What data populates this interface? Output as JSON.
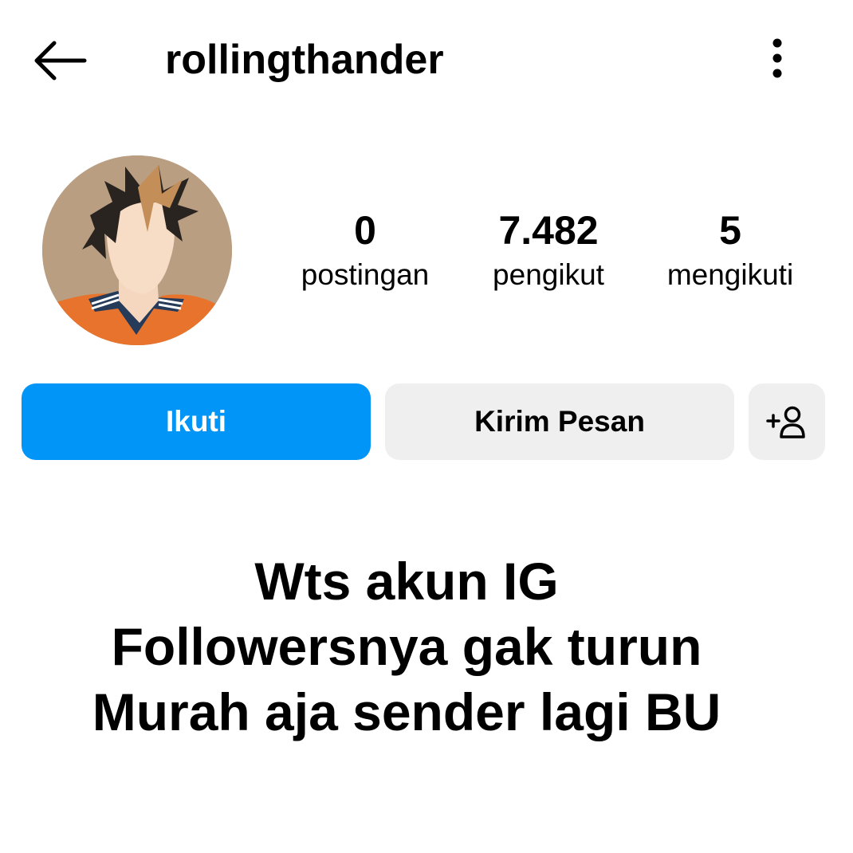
{
  "header": {
    "username": "rollingthander",
    "back_icon": "arrow-left-icon",
    "more_icon": "more-vertical-icon"
  },
  "profile": {
    "avatar": "anime-character-avatar",
    "stats": [
      {
        "value": "0",
        "label": "postingan"
      },
      {
        "value": "7.482",
        "label": "pengikut"
      },
      {
        "value": "5",
        "label": "mengikuti"
      }
    ]
  },
  "actions": {
    "follow_label": "Ikuti",
    "message_label": "Kirim Pesan",
    "suggest_icon": "add-person-icon"
  },
  "bio": {
    "lines": [
      "Wts akun IG",
      "Followersnya gak turun",
      "Murah aja sender lagi BU"
    ]
  },
  "colors": {
    "accent": "#0095f6",
    "secondary_button": "#efefef",
    "avatar_bg": "#b99e82",
    "text": "#000000"
  }
}
